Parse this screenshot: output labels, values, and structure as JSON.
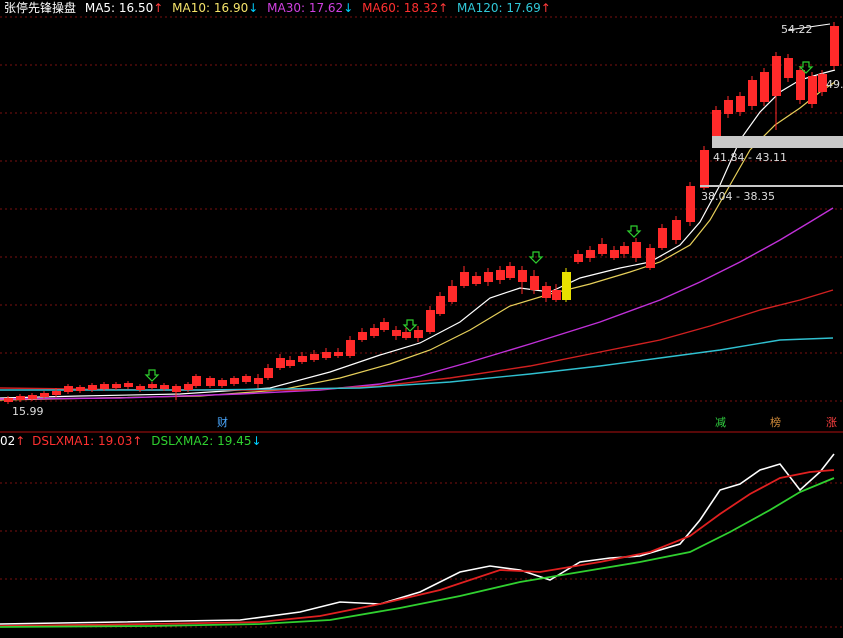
{
  "indicator_name": "张停先锋操盘",
  "ma_legend": [
    {
      "label": "MA5:",
      "value": "16.50",
      "arrow": "↑",
      "color": "#ffffff",
      "arrow_color": "#ff3b3b"
    },
    {
      "label": "MA10:",
      "value": "16.90",
      "arrow": "↓",
      "color": "#f5e36a",
      "arrow_color": "#00d0ff"
    },
    {
      "label": "MA30:",
      "value": "17.62",
      "arrow": "↓",
      "color": "#d040e0",
      "arrow_color": "#00d0ff"
    },
    {
      "label": "MA60:",
      "value": "18.32",
      "arrow": "↑",
      "color": "#ff3030",
      "arrow_color": "#ff3b3b"
    },
    {
      "label": "MA120:",
      "value": "17.69",
      "arrow": "↑",
      "color": "#30c8d8",
      "arrow_color": "#ff3b3b"
    }
  ],
  "price_labels": {
    "high": "54.22",
    "right_edge": "49.",
    "zone1": "41.84 - 43.11",
    "zone2": "38.04 - 38.35",
    "low": "15.99"
  },
  "event_tags": {
    "cai": "财",
    "jian": "减",
    "bang": "榜",
    "zhang": "涨"
  },
  "sub_legend": {
    "prefix": "02",
    "prefix_arrow": "↑",
    "dsl1_label": "DSLXMA1:",
    "dsl1_value": "19.03",
    "dsl1_arrow": "↑",
    "dsl2_label": "DSLXMA2:",
    "dsl2_value": "19.45",
    "dsl2_arrow": "↓"
  },
  "colors": {
    "up": "#ff2a2a",
    "down": "#ff2a2a",
    "signal_green": "#2fd02f",
    "yellow": "#e8e000",
    "grid": "#7a1010",
    "zone_gray": "#c8c8c8"
  }
}
